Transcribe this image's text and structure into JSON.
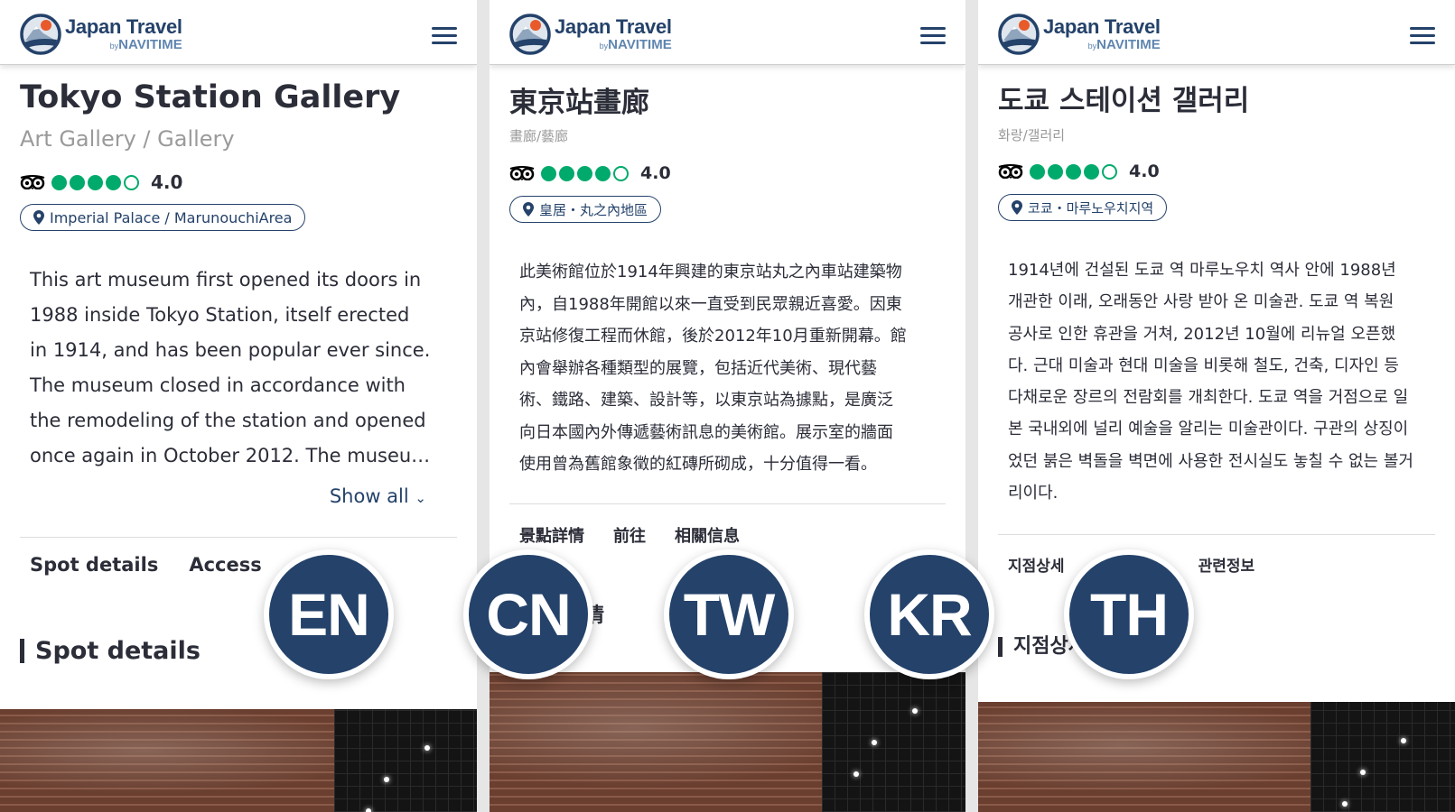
{
  "brand": {
    "name": "Japan Travel",
    "by": "by",
    "sub": "NAVITIME",
    "colors": {
      "primary": "#24426a",
      "rating": "#00aa6c"
    }
  },
  "panels": [
    {
      "lang": "en",
      "title": "Tokyo Station Gallery",
      "category": "Art Gallery / Gallery",
      "rating": "4.0",
      "rating_value": 4,
      "area": "Imperial Palace / MarunouchiArea",
      "description": [
        "This art museum first opened its doors in",
        "1988 inside Tokyo Station, itself erected",
        "in 1914, and has been popular ever since.",
        "The museum closed in accordance with",
        "the remodeling of the station and opened",
        "once again in October 2012. The museu…"
      ],
      "show_all": "Show all",
      "tabs": [
        "Spot details",
        "Access"
      ],
      "section": "Spot details"
    },
    {
      "lang": "zh-tw",
      "title": "東京站畫廊",
      "category": "畫廊/藝廊",
      "rating": "4.0",
      "rating_value": 4,
      "area": "皇居・丸之內地區",
      "description": [
        "此美術館位於1914年興建的東京站丸之內車站建築物",
        "內，自1988年開館以來一直受到民眾親近喜愛。因東",
        "京站修復工程而休館，後於2012年10月重新開幕。館",
        "內會舉辦各種類型的展覽，包括近代美術、現代藝",
        "術、鐵路、建築、設計等，以東京站為據點，是廣泛",
        "向日本國內外傳遞藝術訊息的美術館。展示室的牆面",
        "使用曾為舊館象徵的紅磚所砌成，十分值得一看。"
      ],
      "tabs": [
        "景點詳情",
        "前往",
        "相關信息"
      ],
      "section": "景點詳情"
    },
    {
      "lang": "ko",
      "title": "도쿄 스테이션 갤러리",
      "category": "화랑/갤러리",
      "rating": "4.0",
      "rating_value": 4,
      "area": "코쿄・마루노우치지역",
      "description": [
        "1914년에 건설된 도쿄 역 마루노우치 역사 안에 1988년",
        "개관한 이래, 오래동안 사랑 받아 온 미술관. 도쿄 역 복원",
        "공사로 인한 휴관을 거쳐, 2012년 10월에 리뉴얼 오픈했",
        "다. 근대 미술과 현대 미술을 비롯해 철도, 건축, 디자인 등",
        "다채로운 장르의 전람회를 개최한다. 도쿄 역을 거점으로 일",
        "본 국내외에 널리 예술을 알리는 미술관이다. 구관의 상징이",
        "었던 붉은 벽돌을 벽면에 사용한 전시실도 놓칠 수 없는 볼거",
        "리이다."
      ],
      "tabs": [
        "지점상세",
        "관련정보"
      ],
      "section": "지점상세"
    }
  ],
  "badges": [
    "EN",
    "CN",
    "TW",
    "KR",
    "TH"
  ]
}
